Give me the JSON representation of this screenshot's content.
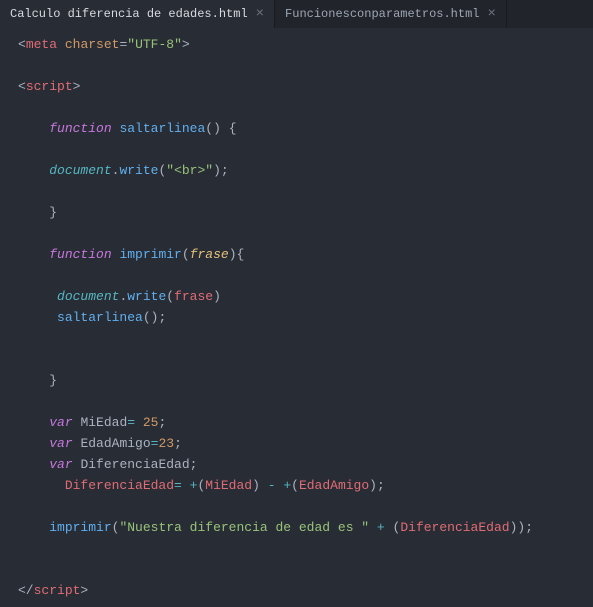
{
  "tabs": [
    {
      "label": "Calculo diferencia de edades.html",
      "active": true
    },
    {
      "label": "Funcionesconparametros.html",
      "active": false
    }
  ],
  "code": {
    "meta_open": "<",
    "meta_tag": "meta",
    "sp": " ",
    "charset_attr": "charset",
    "eq": "=",
    "q": "\"",
    "utf8": "UTF-8",
    "meta_close": ">",
    "script_open_l": "<",
    "script_tag": "script",
    "script_open_r": ">",
    "fn_kw": "function",
    "fn1_name": "saltarlinea",
    "paren_l": "(",
    "paren_r": ")",
    "brace_l": "{",
    "brace_r": "}",
    "document": "document",
    "dot": ".",
    "write": "write",
    "br_str": "\"<br>\"",
    "semi": ";",
    "fn2_name": "imprimir",
    "fn2_param": "frase",
    "call_saltarlinea": "saltarlinea",
    "var_kw": "var",
    "v_miedad": "MiEdad",
    "v_miedad_val": "25",
    "v_edadamigo": "EdadAmigo",
    "v_edadamigo_val": "23",
    "v_diff": "DiferenciaEdad",
    "assign_diff_lhs": "DiferenciaEdad",
    "plus": "+",
    "minus": "-",
    "call_imprimir": "imprimir",
    "msg_str": "\"Nuestra diferencia de edad es \"",
    "script_close_l": "</",
    "script_close_r": ">",
    "eq_op": "= "
  }
}
